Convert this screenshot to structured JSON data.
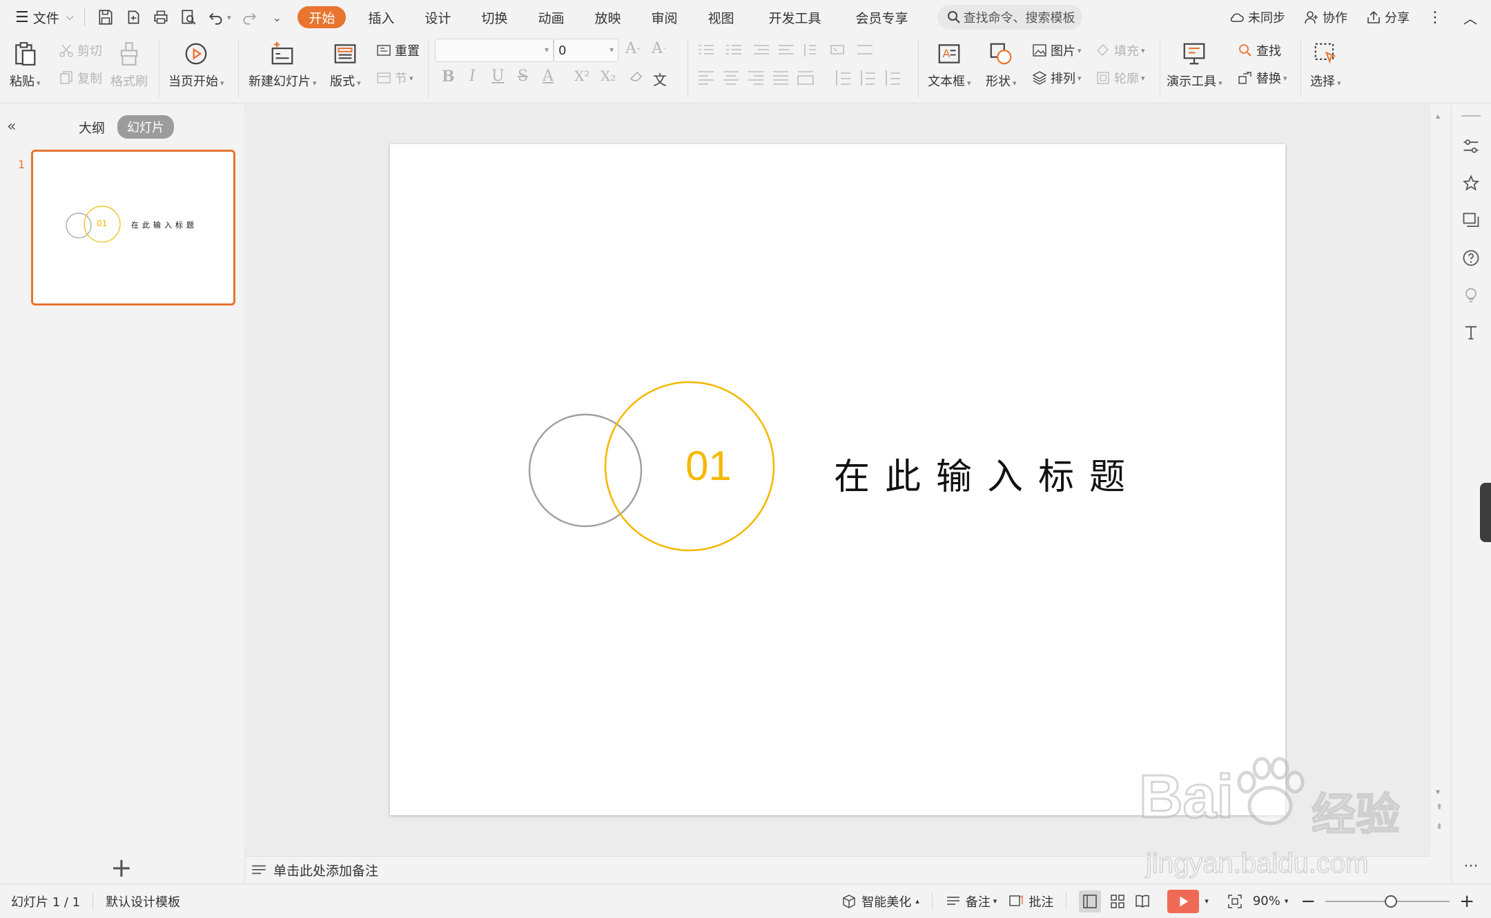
{
  "menubar": {
    "file_label": "文件",
    "tabs": [
      "开始",
      "插入",
      "设计",
      "切换",
      "动画",
      "放映",
      "审阅",
      "视图",
      "开发工具",
      "会员专享"
    ],
    "active_tab": "开始",
    "search_placeholder": "查找命令、搜索模板",
    "sync_label": "未同步",
    "collab_label": "协作",
    "share_label": "分享"
  },
  "ribbon": {
    "paste": "粘贴",
    "cut": "剪切",
    "copy": "复制",
    "format_painter": "格式刷",
    "from_current": "当页开始",
    "new_slide": "新建幻灯片",
    "layout": "版式",
    "reset": "重置",
    "section": "节",
    "font_name": "",
    "font_size": "0",
    "text_box": "文本框",
    "shape": "形状",
    "picture": "图片",
    "fill": "填充",
    "arrange": "排列",
    "outline": "轮廓",
    "presentation_tools": "演示工具",
    "find": "查找",
    "replace": "替换",
    "select": "选择",
    "bold": "B",
    "italic": "I",
    "underline": "U",
    "strike": "S",
    "font_color": "A",
    "superscript": "X²",
    "subscript": "X₂",
    "wen": "文"
  },
  "left_panel": {
    "outline_tab": "大纲",
    "slides_tab": "幻灯片",
    "slide_number": "1",
    "thumb_number": "01",
    "thumb_title": "在此输入标题"
  },
  "slide": {
    "number_text": "01",
    "title": "在此输入标题",
    "accent_color": "#F5B800",
    "gray_color": "#9E9E9E"
  },
  "notes": {
    "placeholder": "单击此处添加备注"
  },
  "statusbar": {
    "slide_info": "幻灯片 1 / 1",
    "template": "默认设计模板",
    "smart_beautify": "智能美化",
    "notes": "备注",
    "comments": "批注",
    "zoom": "90%"
  },
  "watermark": {
    "brand": "Bai",
    "brand2": "经验",
    "url": "jingyan.baidu.com"
  }
}
